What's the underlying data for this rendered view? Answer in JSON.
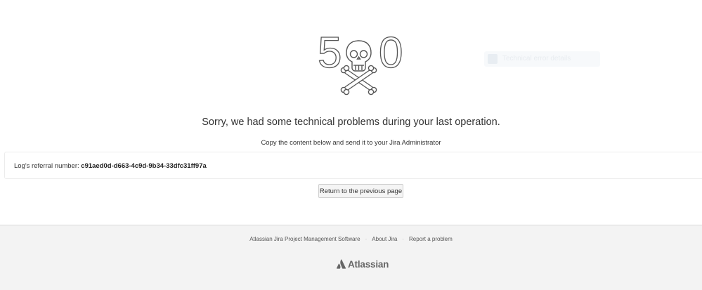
{
  "error": {
    "code_digits": [
      "5",
      "0"
    ],
    "headline": "Sorry, we had some technical problems during your last operation.",
    "instruction": "Copy the content below and send it to your Jira Administrator"
  },
  "hint": {
    "text": "Technical error details"
  },
  "log": {
    "label": "Log's referral number:",
    "referral_number": "c91aed0d-d663-4c9d-9b34-33dfc31ff97a"
  },
  "actions": {
    "return_label": "Return to the previous page"
  },
  "footer": {
    "links": [
      "Atlassian Jira Project Management Software",
      "About Jira",
      "Report a problem"
    ],
    "separator": "·",
    "logo_text": "Atlassian"
  },
  "colors": {
    "text": "#333333",
    "footer_bg": "#f3f3f3",
    "logo": "#666666"
  }
}
